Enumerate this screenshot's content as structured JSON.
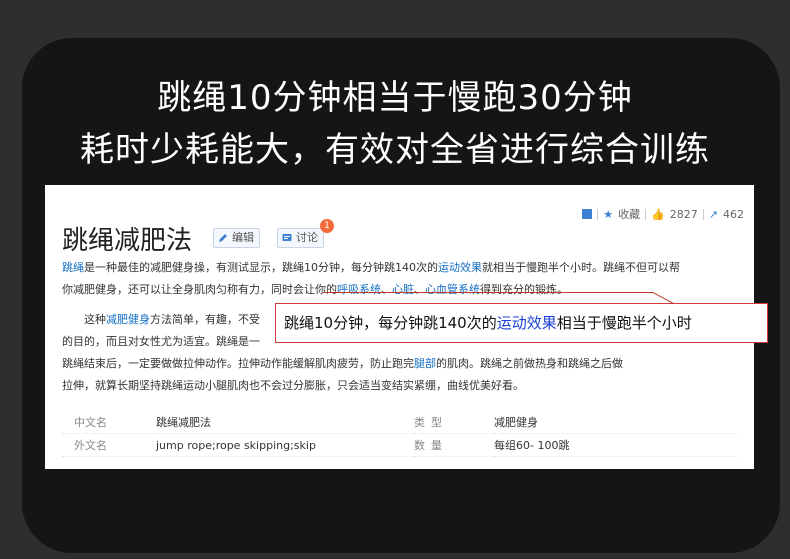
{
  "headline": {
    "line1": "跳绳10分钟相当于慢跑30分钟",
    "line2": "耗时少耗能大，有效对全省进行综合训练"
  },
  "screenshot": {
    "title": "跳绳减肥法",
    "edit_label": "编辑",
    "discuss_label": "讨论",
    "discuss_badge": "1",
    "topbar": {
      "collect_label": "收藏",
      "like_count": "2827",
      "share_count": "462"
    },
    "para1": {
      "line1_a": "跳绳",
      "line1_b": "是一种最佳的减肥健身操，有测试显示，跳绳10分钟，每分钟跳140次的",
      "line1_link": "运动效果",
      "line1_c": "就相当于慢跑半个小时。跳绳不但可以帮",
      "line2_a": "你减肥健身，还可以让全身肌肉匀称有力，同时会让你的",
      "line2_link1": "呼吸系统",
      "line2_sep1": "、",
      "line2_link2": "心脏",
      "line2_sep2": "、",
      "line2_link3": "心血管系统",
      "line2_b": "得到充分的锻炼。"
    },
    "para2": {
      "line1_a": "这种",
      "line1_link": "减肥健身",
      "line1_b": "方法简单，有趣，不受",
      "line2": "的目的，而且对女性尤为适宜。跳绳是一",
      "line3_a": "跳绳结束后，一定要做做拉伸动作。拉伸动作能缓解肌肉疲劳，防止跑完",
      "line3_link": "腿部",
      "line3_b": "的肌肉。跳绳之前做热身和跳绳之后做",
      "line4": "拉伸，就算长期坚持跳绳运动小腿肌肉也不会过分膨胀，只会适当变结实紧绷，曲线优美好看。"
    },
    "callout": {
      "text_a": "跳绳10分钟，每分钟跳140次的",
      "text_link": "运动效果",
      "text_b": "相当于慢跑半个小时"
    },
    "info_table": [
      {
        "k1": "中文名",
        "v1": "跳绳减肥法",
        "k2": "类型",
        "v2": "减肥健身"
      },
      {
        "k1": "外文名",
        "v1": "jump rope;rope skipping;skip",
        "k2": "数量",
        "v2": "每组60- 100跳"
      }
    ]
  },
  "colors": {
    "outer_bg": "#2e2e2e",
    "panel_bg": "#151515",
    "link": "#136ec2",
    "callout_border": "#d03a3a",
    "badge": "#f26b3a"
  }
}
